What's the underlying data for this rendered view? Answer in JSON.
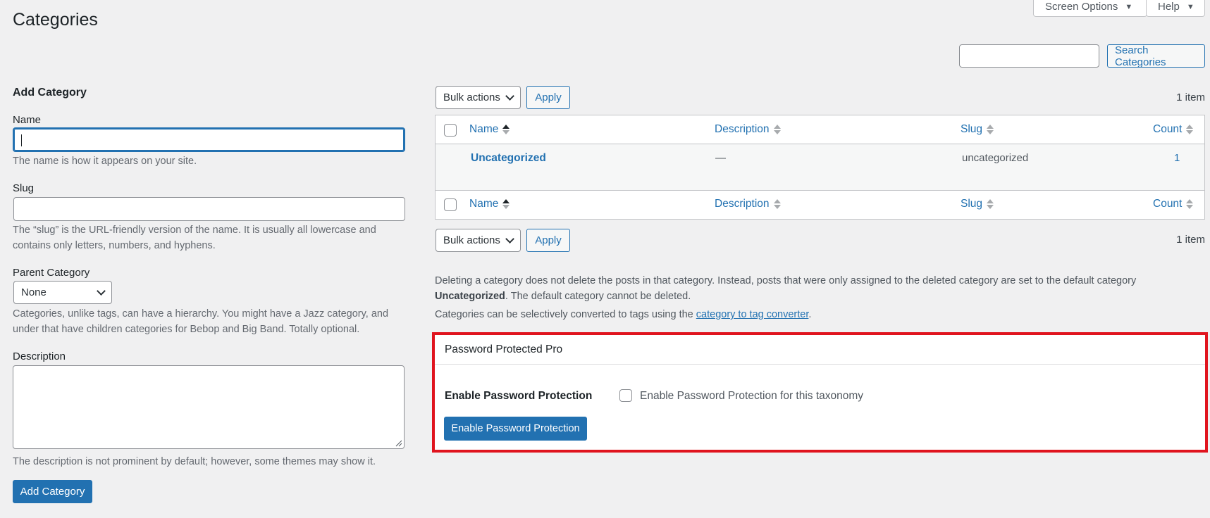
{
  "header": {
    "page_title": "Categories",
    "screen_options_label": "Screen Options",
    "help_label": "Help"
  },
  "search": {
    "input_value": "",
    "button_label": "Search Categories"
  },
  "add_form": {
    "heading": "Add Category",
    "name_label": "Name",
    "name_value": "",
    "name_help": "The name is how it appears on your site.",
    "slug_label": "Slug",
    "slug_value": "",
    "slug_help_line1": "The “slug” is the URL-friendly version of the name. It is usually all lowercase and",
    "slug_help_line2": "contains only letters, numbers, and hyphens.",
    "parent_label": "Parent Category",
    "parent_selected": "None",
    "parent_help_line1": "Categories, unlike tags, can have a hierarchy. You might have a Jazz category, and",
    "parent_help_line2": "under that have children categories for Bebop and Big Band. Totally optional.",
    "description_label": "Description",
    "description_value": "",
    "description_help": "The description is not prominent by default; however, some themes may show it.",
    "submit_label": "Add Category"
  },
  "table": {
    "bulk_actions_label": "Bulk actions",
    "apply_label": "Apply",
    "item_count": "1 item",
    "columns": {
      "name": "Name",
      "description": "Description",
      "slug": "Slug",
      "count": "Count"
    },
    "rows": [
      {
        "name": "Uncategorized",
        "description": "—",
        "slug": "uncategorized",
        "count": "1"
      }
    ]
  },
  "notes": {
    "line1": "Deleting a category does not delete the posts in that category. Instead, posts that were only assigned to the deleted category are set to the default category",
    "line2_bold": "Uncategorized",
    "line2_rest": ". The default category cannot be deleted.",
    "line3_pre": "Categories can be selectively converted to tags using the ",
    "line3_link": "category to tag converter",
    "line3_post": "."
  },
  "password_protected": {
    "panel_title": "Password Protected Pro",
    "field_label": "Enable Password Protection",
    "checkbox_label": "Enable Password Protection for this taxonomy",
    "button_label": "Enable Password Protection",
    "highlight_color": "#e0141e"
  },
  "colors": {
    "primary": "#2271b1",
    "background": "#f0f0f1"
  }
}
